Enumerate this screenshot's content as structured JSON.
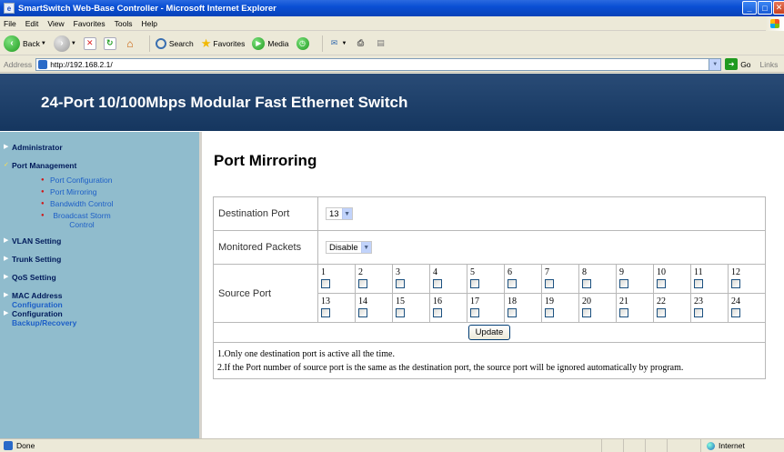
{
  "window": {
    "title": "SmartSwitch Web-Base Controller - Microsoft Internet Explorer"
  },
  "menu": [
    "File",
    "Edit",
    "View",
    "Favorites",
    "Tools",
    "Help"
  ],
  "toolbar": {
    "back_label": "Back",
    "search_label": "Search",
    "favorites_label": "Favorites",
    "media_label": "Media"
  },
  "address": {
    "label": "Address",
    "url": "http://192.168.2.1/",
    "go_label": "Go",
    "links_label": "Links"
  },
  "banner": {
    "title": "24-Port 10/100Mbps Modular Fast Ethernet Switch"
  },
  "nav": {
    "administrator": "Administrator",
    "port_management": "Port Management",
    "port_sub": [
      "Port Configuration",
      "Port Mirroring",
      "Bandwidth Control",
      "Broadcast Storm Control"
    ],
    "vlan": "VLAN Setting",
    "trunk": "Trunk Setting",
    "qos": "QoS Setting",
    "mac_line1": "MAC Address",
    "mac_line2": "Configuration",
    "config_line1": "Configuration",
    "config_line2": "Backup/Recovery"
  },
  "main": {
    "title": "Port Mirroring",
    "destination_label": "Destination Port",
    "destination_value": "13",
    "monitored_label": "Monitored Packets",
    "monitored_value": "Disable",
    "source_label": "Source Port",
    "ports_row1": [
      "1",
      "2",
      "3",
      "4",
      "5",
      "6",
      "7",
      "8",
      "9",
      "10",
      "11",
      "12"
    ],
    "ports_row2": [
      "13",
      "14",
      "15",
      "16",
      "17",
      "18",
      "19",
      "20",
      "21",
      "22",
      "23",
      "24"
    ],
    "update_label": "Update",
    "note1": "1.Only one destination port is active all the time.",
    "note2": "2.If the Port number of source port is the same as the destination port, the source port will be ignored automatically by program."
  },
  "status": {
    "left": "Done",
    "zone": "Internet"
  }
}
